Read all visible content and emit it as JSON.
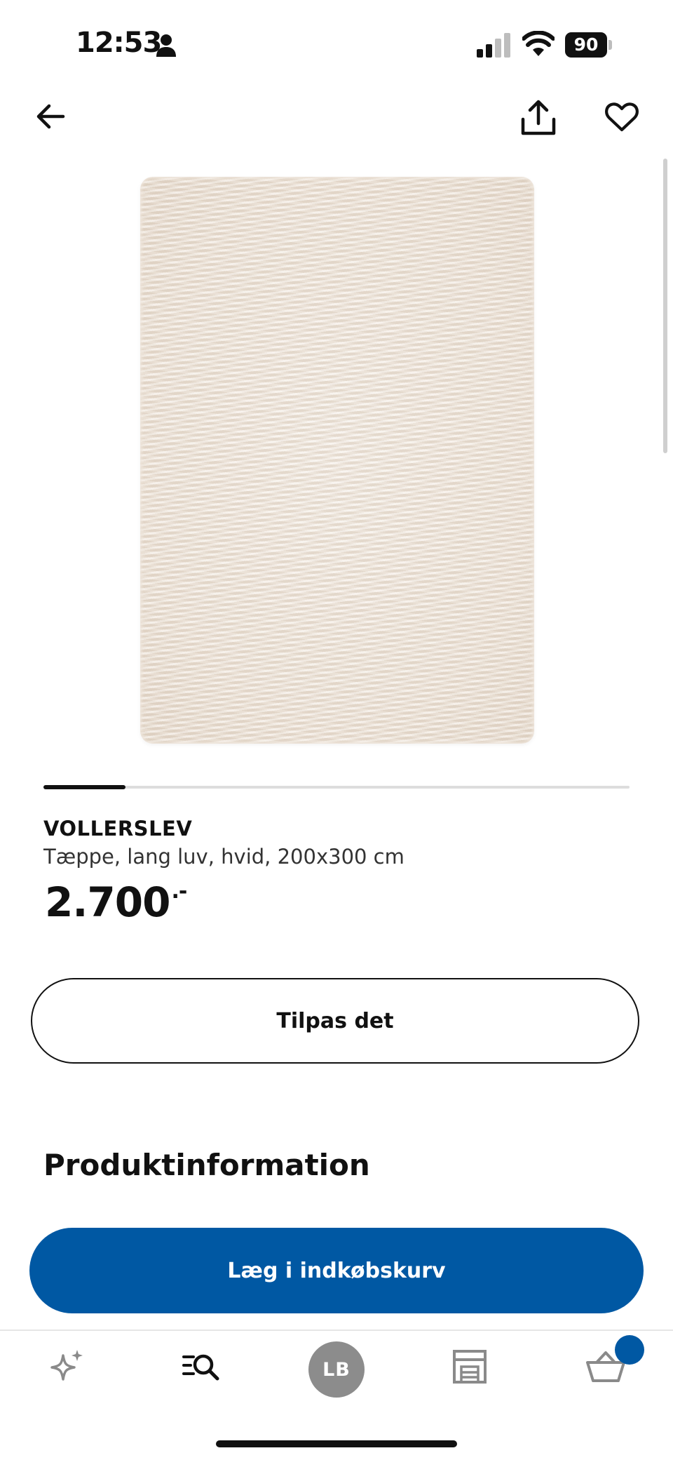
{
  "status_bar": {
    "time": "12:53",
    "battery": "90"
  },
  "carousel": {
    "progress": 0.14
  },
  "product": {
    "name": "VOLLERSLEV",
    "description": "Tæppe, lang luv, hvid, 200x300 cm",
    "price": "2.700",
    "price_suffix": ".-"
  },
  "actions": {
    "customize_label": "Tilpas det",
    "add_to_cart_label": "Læg i indkøbskurv"
  },
  "sections": {
    "product_info_title": "Produktinformation"
  },
  "tabbar": {
    "avatar_initials": "LB",
    "has_cart_badge": true
  },
  "colors": {
    "brand_blue": "#0058a3",
    "text": "#111111",
    "rug": "#ede2d6"
  },
  "icons": [
    "person-icon",
    "signal-icon",
    "wifi-icon",
    "battery-icon",
    "back-arrow-icon",
    "share-icon",
    "heart-icon",
    "sparkle-icon",
    "search-list-icon",
    "store-icon",
    "basket-icon"
  ]
}
